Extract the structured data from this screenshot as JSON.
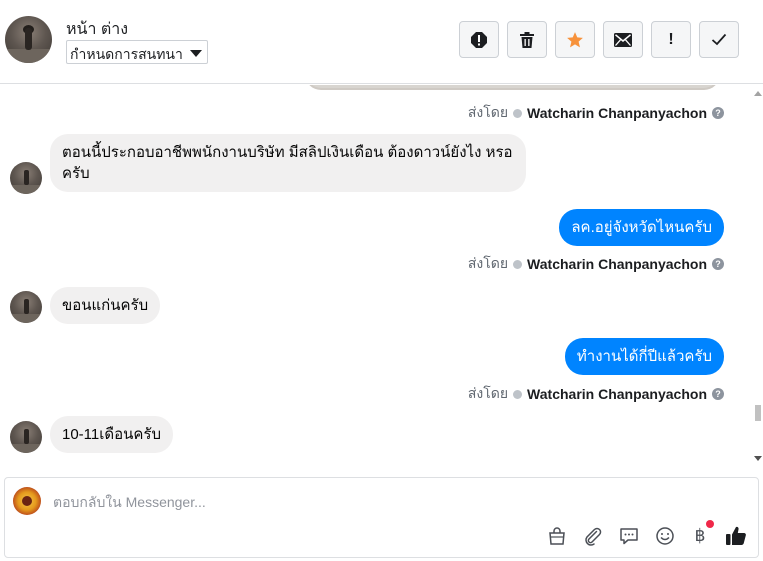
{
  "header": {
    "title": "หน้า ต่าง",
    "status_select": "กำหนดการสนทนา",
    "actions": [
      {
        "name": "report-icon",
        "glyph": "!"
      },
      {
        "name": "trash-icon"
      },
      {
        "name": "star-icon"
      },
      {
        "name": "mail-icon"
      },
      {
        "name": "mark-unread-icon",
        "glyph": "!"
      },
      {
        "name": "checkmark-icon"
      }
    ]
  },
  "thread": {
    "sent_by_prefix": "ส่งโดย",
    "sender_name": "Watcharin Chanpanyachon",
    "help_glyph": "?",
    "messages": [
      {
        "dir": "in",
        "text": "ตอนนี้ประกอบอาชีพพนักงานบริษัท มีสลิปเงินเดือน ต้องดาวน์ยังไง หรอครับ"
      },
      {
        "dir": "out",
        "text": "ลค.อยู่จังหวัดไหนครับ"
      },
      {
        "dir": "in",
        "text": "ขอนแก่นครับ"
      },
      {
        "dir": "out",
        "text": "ทำงานได้กี่ปีแล้วครับ"
      },
      {
        "dir": "in",
        "text": "10-11เดือนครับ"
      }
    ]
  },
  "composer": {
    "placeholder": "ตอบกลับใน Messenger...",
    "value": "",
    "icons": [
      "shopping-bag-icon",
      "paperclip-icon",
      "chat-bubble-icon",
      "emoji-icon",
      "baht-icon",
      "thumbs-up-icon"
    ],
    "baht_glyph": "฿"
  },
  "colors": {
    "accent": "#0084ff",
    "incoming_bubble": "#f1f0f0",
    "star": "#f7923b",
    "notification": "#f02849"
  }
}
